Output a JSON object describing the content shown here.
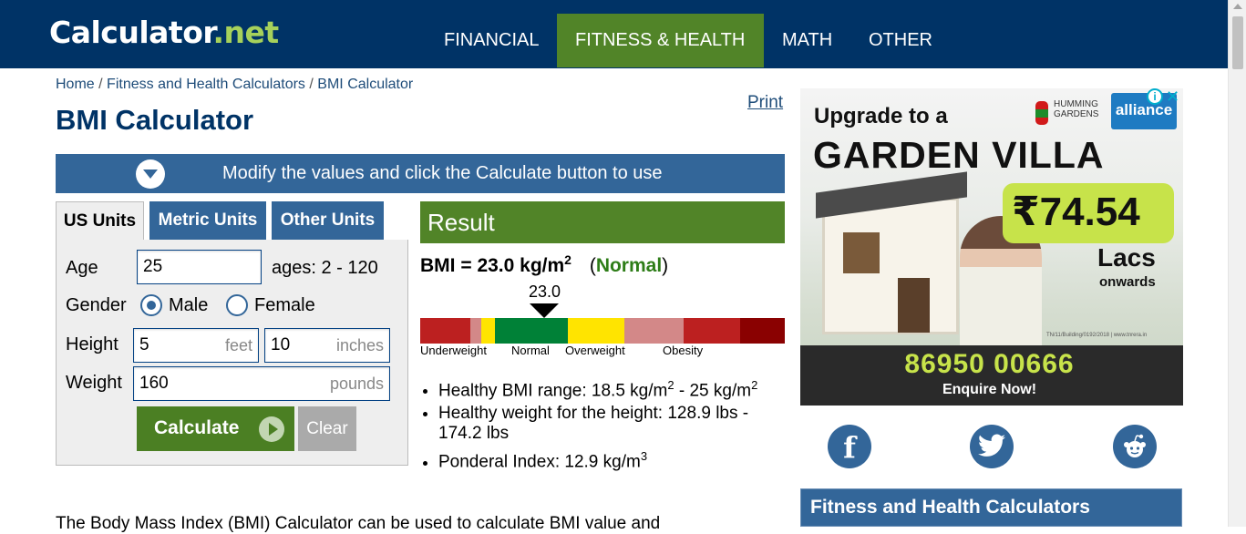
{
  "header": {
    "logo_main": "Calculator",
    "logo_dot": ".",
    "logo_tld": "net",
    "nav": [
      {
        "label": "FINANCIAL",
        "active": false
      },
      {
        "label": "FITNESS & HEALTH",
        "active": true
      },
      {
        "label": "MATH",
        "active": false
      },
      {
        "label": "OTHER",
        "active": false
      }
    ]
  },
  "breadcrumb": [
    "Home",
    "Fitness and Health Calculators",
    "BMI Calculator"
  ],
  "breadcrumb_separator": "/",
  "print_label": "Print",
  "page_title": "BMI Calculator",
  "instruction": "Modify the values and click the Calculate button to use",
  "tabs": [
    "US Units",
    "Metric Units",
    "Other Units"
  ],
  "active_tab": "US Units",
  "form": {
    "age_label": "Age",
    "age_value": "25",
    "age_hint": "ages: 2 - 120",
    "gender_label": "Gender",
    "gender_options": [
      "Male",
      "Female"
    ],
    "gender_selected": "Male",
    "height_label": "Height",
    "height_feet": "5",
    "height_feet_unit": "feet",
    "height_inches": "10",
    "height_inches_unit": "inches",
    "weight_label": "Weight",
    "weight_value": "160",
    "weight_unit": "pounds",
    "calculate_label": "Calculate",
    "clear_label": "Clear"
  },
  "result": {
    "header": "Result",
    "bmi_prefix": "BMI = ",
    "bmi_value": "23.0 kg/m",
    "bmi_exp": "2",
    "status_open": "(",
    "status": "Normal",
    "status_close": ")",
    "pointer_value": "23.0",
    "bar_labels": [
      "Underweight",
      "Normal",
      "Overweight",
      "Obesity"
    ],
    "bar_colors": [
      "#bc2020",
      "#d38888",
      "#ffe400",
      "#008137",
      "#ffe400",
      "#d38888",
      "#bc2020",
      "#8a0101"
    ],
    "items": [
      {
        "text": "Healthy BMI range: 18.5 kg/m",
        "exp": "2",
        "text2": " - 25 kg/m",
        "exp2": "2"
      },
      {
        "text": "Healthy weight for the height: 128.9 lbs - 174.2 lbs"
      },
      {
        "text": "Ponderal Index: 12.9 kg/m",
        "exp": "3"
      }
    ]
  },
  "intro_text": "The Body Mass Index (BMI) Calculator can be used to calculate BMI value and",
  "ad": {
    "headline": "Upgrade to a",
    "big": "GARDEN VILLA",
    "brand_hg": [
      "HUMMING",
      "GARDENS"
    ],
    "brand_alliance": "alliance",
    "info_icon": "i",
    "close_icon": "✕",
    "price": "₹74.54",
    "unit": "Lacs",
    "onwards": "onwards",
    "phone": "86950 00666",
    "cta": "Enquire Now!",
    "fineprint": "TN/11/Building/0192/2018 | www.tnrera.in"
  },
  "social": [
    "facebook-icon",
    "twitter-icon",
    "reddit-icon"
  ],
  "sidebar_heading": "Fitness and Health Calculators"
}
